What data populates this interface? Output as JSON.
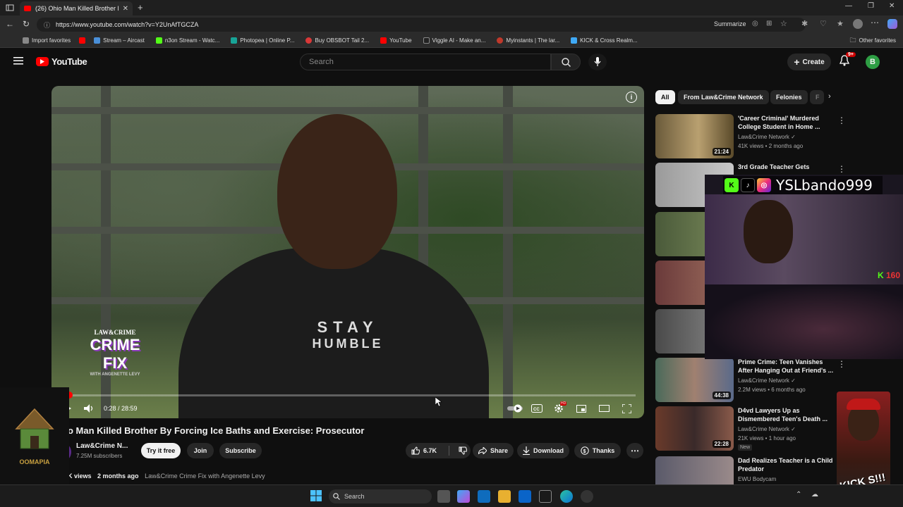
{
  "browser": {
    "tab_title": "(26) Ohio Man Killed Brother By F",
    "url": "https://www.youtube.com/watch?v=Y2UnAfTGCZA",
    "summarize": "Summarize",
    "bookmarks": [
      {
        "label": "Import favorites",
        "color": "#888888"
      },
      {
        "label": "",
        "color": "#ff0000"
      },
      {
        "label": "Stream – Aircast",
        "color": "#4a90d9"
      },
      {
        "label": "n3on Stream - Watc...",
        "color": "#53fc18"
      },
      {
        "label": "Photopea | Online P...",
        "color": "#18a497"
      },
      {
        "label": "Buy OBSBOT Tail 2...",
        "color": "#d93838"
      },
      {
        "label": "YouTube",
        "color": "#ff0000"
      },
      {
        "label": "Viggle AI - Make an...",
        "color": "#222222"
      },
      {
        "label": "Myinstants | The lar...",
        "color": "#c0392b"
      },
      {
        "label": "KICK & Cross Realm...",
        "color": "#3fa9f5"
      }
    ],
    "other_favorites": "Other favorites"
  },
  "youtube": {
    "logo_text": "YouTube",
    "search_placeholder": "Search",
    "create_label": "Create",
    "notif_badge": "9+",
    "avatar_letter": "B"
  },
  "video": {
    "overlay_brand": "LAW&CRIME",
    "overlay_title1": "CRIME",
    "overlay_title2": "FIX",
    "overlay_sub": "WITH ANGENETTE LEVY",
    "shirt_text": "STAY",
    "shirt_text2": "HUMBLE",
    "time": "0:28 / 28:59",
    "progress": 0.016,
    "title": "o Man Killed Brother By Forcing Ice Baths and Exercise: Prosecutor",
    "channel": "Law&Crime N...",
    "subscribers": "7.25M subscribers",
    "try_free": "Try it free",
    "join": "Join",
    "subscribe": "Subscribe",
    "likes": "6.7K",
    "share": "Share",
    "download": "Download",
    "thanks": "Thanks",
    "views": "K views",
    "posted": "2 months ago",
    "playlist": "Law&Crime Crime Fix with Angenette Levy"
  },
  "sidebar": {
    "chips": [
      "All",
      "From Law&Crime Network",
      "Felonies",
      "F"
    ],
    "recs": [
      {
        "title": "'Career Criminal' Murdered College Student in Home ...",
        "channel": "Law&Crime Network",
        "meta": "41K views • 2 months ago",
        "duration": "21:24",
        "thumb": "#6a5a3a",
        "new": ""
      },
      {
        "title": "3rd Grade Teacher Gets",
        "channel": "",
        "meta": "",
        "duration": "",
        "thumb": "#9a9a9a",
        "new": ""
      },
      {
        "title": "",
        "channel": "",
        "meta": "",
        "duration": "",
        "thumb": "#4a5a3a",
        "new": ""
      },
      {
        "title": "",
        "channel": "",
        "meta": "",
        "duration": "",
        "thumb": "#6a3a3a",
        "new": ""
      },
      {
        "title": "",
        "channel": "",
        "meta": "",
        "duration": "",
        "thumb": "#4a4a4a",
        "new": ""
      },
      {
        "title": "Prime Crime: Teen Vanishes After Hanging Out at Friend's ...",
        "channel": "Law&Crime Network",
        "meta": "2.2M views • 6 months ago",
        "duration": "44:38",
        "thumb": "#4a6a5a",
        "new": ""
      },
      {
        "title": "D4vd Lawyers Up as Dismembered Teen's Death ...",
        "channel": "Law&Crime Network",
        "meta": "21K views • 1 hour ago",
        "duration": "22:28",
        "thumb": "#6a3a2a",
        "new": "New"
      },
      {
        "title": "Dad Realizes Teacher is a Child Predator",
        "channel": "EWU Bodycam",
        "meta": "",
        "duration": "",
        "thumb": "#5a5a6a",
        "new": ""
      }
    ]
  },
  "stream": {
    "handle": "YSLbando999",
    "viewer_count": "160",
    "streamer_logo": "OOMAPIA",
    "meme_text": "KICK S!!!"
  },
  "taskbar": {
    "search_placeholder": "Search"
  }
}
